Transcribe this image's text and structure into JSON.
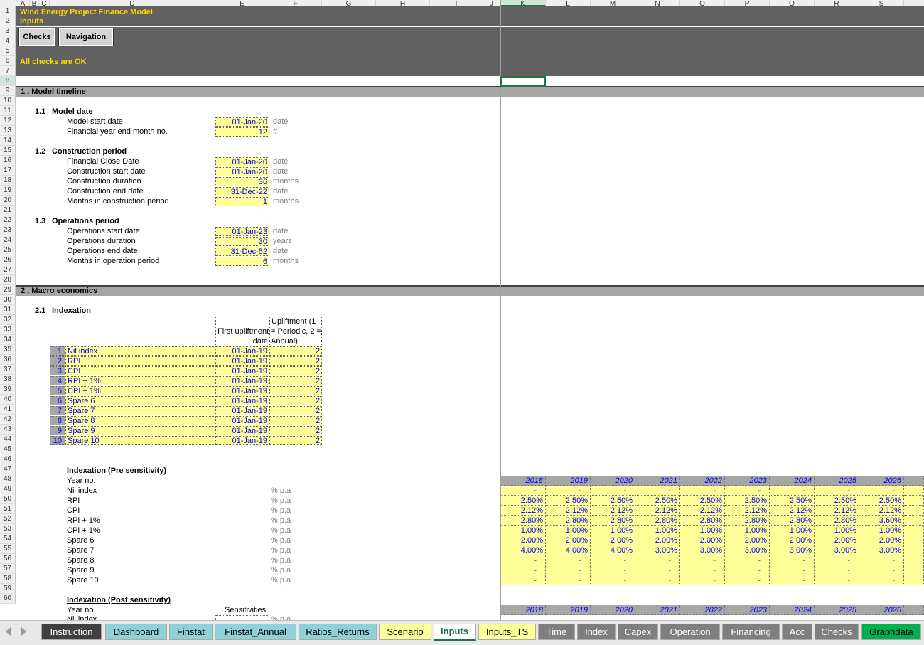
{
  "sheet": {
    "columns": [
      "A",
      "B",
      "C",
      "D",
      "E",
      "F",
      "G",
      "H",
      "I",
      "J",
      "K",
      "L",
      "M",
      "N",
      "O",
      "P",
      "Q",
      "R",
      "S"
    ],
    "selected_column": "K",
    "selected_row": "8",
    "rows": [
      "1",
      "2",
      "3",
      "4",
      "5",
      "6",
      "7",
      "8",
      "9",
      "10",
      "11",
      "12",
      "13",
      "14",
      "15",
      "16",
      "17",
      "18",
      "19",
      "20",
      "21",
      "22",
      "23",
      "24",
      "25",
      "26",
      "27",
      "28",
      "29",
      "30",
      "31",
      "32",
      "33",
      "34",
      "35",
      "36",
      "37",
      "38",
      "39",
      "40",
      "41",
      "42",
      "43",
      "44",
      "45",
      "46",
      "47",
      "48",
      "49",
      "50",
      "51",
      "52",
      "53",
      "54",
      "55",
      "56",
      "57",
      "58",
      "59",
      "60"
    ]
  },
  "header": {
    "title": "Wind Energy Project Finance Model",
    "subtitle": "Inputs",
    "checks_button": "Checks",
    "navigation_button": "Navigation",
    "status": "All checks are OK",
    "colors": {
      "banner": "#616161",
      "status_text": "#ffd700"
    }
  },
  "section1": {
    "title": "1 .  Model timeline",
    "s11": {
      "num": "1.1",
      "title": "Model date",
      "rows": [
        {
          "label": "Model start date",
          "value": "01-Jan-20",
          "unit": "date"
        },
        {
          "label": "Financial year end month no.",
          "value": "12",
          "unit": "#"
        }
      ]
    },
    "s12": {
      "num": "1.2",
      "title": "Construction period",
      "rows": [
        {
          "label": "Financial Close Date",
          "value": "01-Jan-20",
          "unit": "date"
        },
        {
          "label": "Construction start date",
          "value": "01-Jan-20",
          "unit": "date"
        },
        {
          "label": "Construction duration",
          "value": "36",
          "unit": "months"
        },
        {
          "label": "Construction end date",
          "value": "31-Dec-22",
          "unit": "date"
        },
        {
          "label": "Months in construction period",
          "value": "1",
          "unit": "months"
        }
      ]
    },
    "s13": {
      "num": "1.3",
      "title": "Operations period",
      "rows": [
        {
          "label": "Operations start date",
          "value": "01-Jan-23",
          "unit": "date"
        },
        {
          "label": "Operations duration",
          "value": "30",
          "unit": "years"
        },
        {
          "label": "Operations end date",
          "value": "31-Dec-52",
          "unit": "date"
        },
        {
          "label": "Months in operation period",
          "value": "6",
          "unit": "months"
        }
      ]
    }
  },
  "section2": {
    "title": "2 .  Macro economics",
    "s21": {
      "num": "2.1",
      "title": "Indexation",
      "col_first": "First upliftment date",
      "col_first_l1": "First upliftment",
      "col_first_l2": "date",
      "col_uplift_l1": "Upliftment (1",
      "col_uplift_l2": "= Periodic, 2 =",
      "col_uplift_l3": "Annual)",
      "indices": [
        {
          "n": "1",
          "name": "Nil index",
          "date": "01-Jan-19",
          "up": "2"
        },
        {
          "n": "2",
          "name": "RPI",
          "date": "01-Jan-19",
          "up": "2"
        },
        {
          "n": "3",
          "name": "CPI",
          "date": "01-Jan-19",
          "up": "2"
        },
        {
          "n": "4",
          "name": "RPI + 1%",
          "date": "01-Jan-19",
          "up": "2"
        },
        {
          "n": "5",
          "name": "CPI + 1%",
          "date": "01-Jan-19",
          "up": "2"
        },
        {
          "n": "6",
          "name": "Spare 6",
          "date": "01-Jan-19",
          "up": "2"
        },
        {
          "n": "7",
          "name": "Spare 7",
          "date": "01-Jan-19",
          "up": "2"
        },
        {
          "n": "8",
          "name": "Spare 8",
          "date": "01-Jan-19",
          "up": "2"
        },
        {
          "n": "9",
          "name": "Spare 9",
          "date": "01-Jan-19",
          "up": "2"
        },
        {
          "n": "10",
          "name": "Spare 10",
          "date": "01-Jan-19",
          "up": "2"
        }
      ]
    },
    "pre": {
      "title": "Indexation (Pre sensitivity)",
      "year_label": "Year no.",
      "years": [
        "2018",
        "2019",
        "2020",
        "2021",
        "2022",
        "2023",
        "2024",
        "2025",
        "2026"
      ],
      "rows": [
        {
          "label": "Nil index",
          "unit": "% p.a",
          "values": [
            "-",
            "-",
            "-",
            "-",
            "-",
            "-",
            "-",
            "-",
            "-"
          ]
        },
        {
          "label": "RPI",
          "unit": "% p.a",
          "values": [
            "2.50%",
            "2.50%",
            "2.50%",
            "2.50%",
            "2.50%",
            "2.50%",
            "2.50%",
            "2.50%",
            "2.50%"
          ]
        },
        {
          "label": "CPI",
          "unit": "% p.a",
          "values": [
            "2.12%",
            "2.12%",
            "2.12%",
            "2.12%",
            "2.12%",
            "2.12%",
            "2.12%",
            "2.12%",
            "2.12%"
          ]
        },
        {
          "label": "RPI + 1%",
          "unit": "% p.a",
          "values": [
            "2.80%",
            "2.80%",
            "2.80%",
            "2.80%",
            "2.80%",
            "2.80%",
            "2.80%",
            "2.80%",
            "3.60%"
          ]
        },
        {
          "label": "CPI + 1%",
          "unit": "% p.a",
          "values": [
            "1.00%",
            "1.00%",
            "1.00%",
            "1.00%",
            "1.00%",
            "1.00%",
            "1.00%",
            "1.00%",
            "1.00%"
          ]
        },
        {
          "label": "Spare 6",
          "unit": "% p.a",
          "values": [
            "2.00%",
            "2.00%",
            "2.00%",
            "2.00%",
            "2.00%",
            "2.00%",
            "2.00%",
            "2.00%",
            "2.00%"
          ]
        },
        {
          "label": "Spare 7",
          "unit": "% p.a",
          "values": [
            "4.00%",
            "4.00%",
            "4.00%",
            "3.00%",
            "3.00%",
            "3.00%",
            "3.00%",
            "3.00%",
            "3.00%"
          ]
        },
        {
          "label": "Spare 8",
          "unit": "% p.a",
          "values": [
            "-",
            "-",
            "-",
            "-",
            "-",
            "-",
            "-",
            "-",
            "-"
          ]
        },
        {
          "label": "Spare 9",
          "unit": "% p.a",
          "values": [
            "-",
            "-",
            "-",
            "-",
            "-",
            "-",
            "-",
            "-",
            "-"
          ]
        },
        {
          "label": "Spare 10",
          "unit": "% p.a",
          "values": [
            "-",
            "-",
            "-",
            "-",
            "-",
            "-",
            "-",
            "-",
            "-"
          ]
        }
      ]
    },
    "post": {
      "title": "Indexation (Post sensitivity)",
      "year_label": "Year no.",
      "sens_label": "Sensitivities",
      "years": [
        "2018",
        "2019",
        "2020",
        "2021",
        "2022",
        "2023",
        "2024",
        "2025",
        "2026"
      ],
      "first_row_label": "Nil index",
      "first_row_unit": "% p.a"
    }
  },
  "tabs": [
    {
      "label": "Instruction",
      "color": "#404040",
      "text": "#ffffff"
    },
    {
      "label": "Dashboard",
      "color": "#8ed1d9",
      "text": "#000000"
    },
    {
      "label": "Finstat",
      "color": "#8ed1d9",
      "text": "#000000"
    },
    {
      "label": "Finstat_Annual",
      "color": "#8ed1d9",
      "text": "#000000"
    },
    {
      "label": "Ratios_Returns",
      "color": "#8ed1d9",
      "text": "#000000"
    },
    {
      "label": "Scenario",
      "color": "#ffff99",
      "text": "#000000"
    },
    {
      "label": "Inputs",
      "color": "#ffffff",
      "text": "#217346",
      "active": true
    },
    {
      "label": "Inputs_TS",
      "color": "#ffff99",
      "text": "#000000"
    },
    {
      "label": "Time",
      "color": "#7f7f7f",
      "text": "#ffffff"
    },
    {
      "label": "Index",
      "color": "#7f7f7f",
      "text": "#ffffff"
    },
    {
      "label": "Capex",
      "color": "#7f7f7f",
      "text": "#ffffff"
    },
    {
      "label": "Operation",
      "color": "#7f7f7f",
      "text": "#ffffff"
    },
    {
      "label": "Financing",
      "color": "#7f7f7f",
      "text": "#ffffff"
    },
    {
      "label": "Acc",
      "color": "#7f7f7f",
      "text": "#ffffff"
    },
    {
      "label": "Checks",
      "color": "#7f7f7f",
      "text": "#ffffff"
    },
    {
      "label": "Graphdata",
      "color": "#00b050",
      "text": "#000000"
    }
  ]
}
